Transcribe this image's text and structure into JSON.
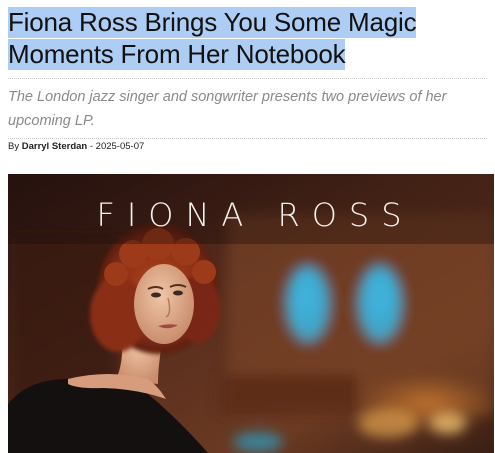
{
  "article": {
    "headline_line1": "Fiona Ross Brings You Some Magic",
    "headline_line2": "Moments From Her Notebook",
    "subtitle_line1": "The London jazz singer and songwriter presents two previews of her",
    "subtitle_line2": "upcoming LP.",
    "byline_prefix": "By ",
    "author": "Darryl Sterdan",
    "byline_separator": " - ",
    "date": "2025-05-07"
  },
  "hero_image": {
    "cover_text": "FIONA ROSS"
  },
  "colors": {
    "selection_highlight": "#aecdf4",
    "subtitle_gray": "#8a8a8a"
  }
}
